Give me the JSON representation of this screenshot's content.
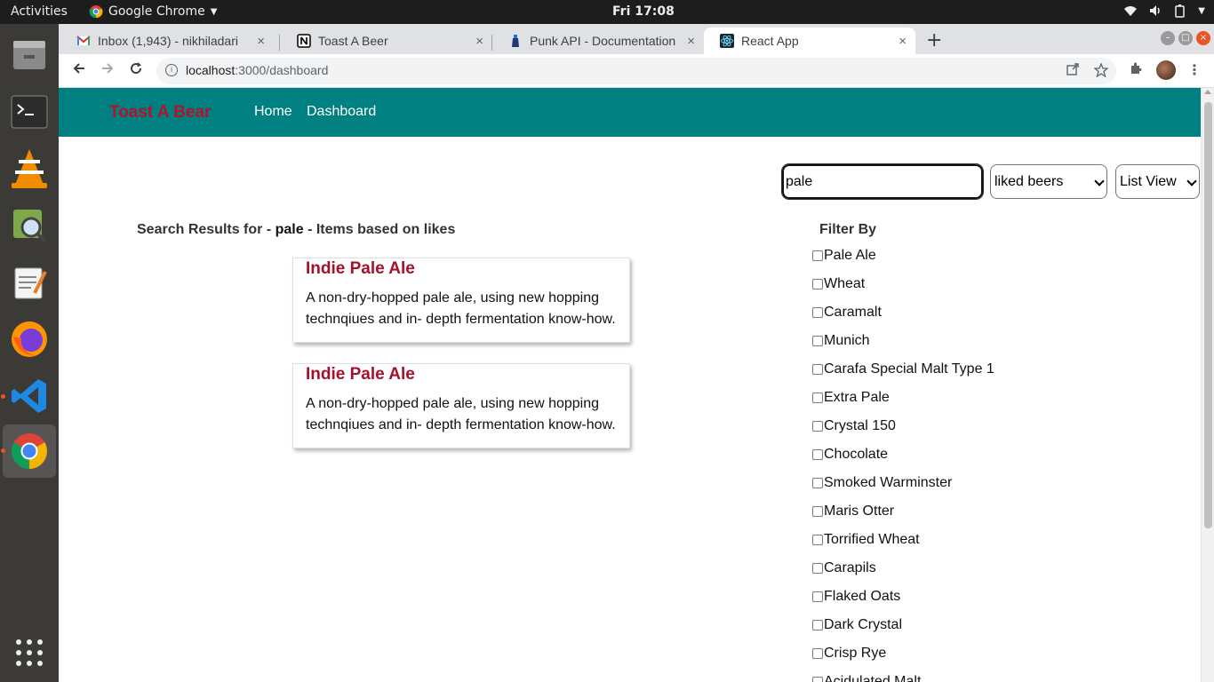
{
  "system_bar": {
    "activities": "Activities",
    "app_name": "Google Chrome",
    "clock": "Fri 17:08"
  },
  "dock": {
    "items": [
      {
        "name": "files-icon"
      },
      {
        "name": "terminal-icon"
      },
      {
        "name": "vlc-icon"
      },
      {
        "name": "image-viewer-icon"
      },
      {
        "name": "text-editor-icon"
      },
      {
        "name": "firefox-icon"
      },
      {
        "name": "vscode-icon"
      },
      {
        "name": "chrome-icon"
      }
    ],
    "show_apps": "show-apps-icon"
  },
  "browser": {
    "tabs": [
      {
        "title": "Inbox (1,943) - nikhiladari",
        "icon": "gmail-icon",
        "close": "×"
      },
      {
        "title": "Toast A Beer",
        "icon": "notion-icon",
        "close": "×"
      },
      {
        "title": "Punk API - Documentation",
        "icon": "punk-api-icon",
        "close": "×"
      },
      {
        "title": "React App",
        "icon": "react-icon",
        "close": "×"
      }
    ],
    "new_tab": "+",
    "url_host": "localhost",
    "url_rest": ":3000/dashboard"
  },
  "app": {
    "brand": "Toast A Bear",
    "nav": {
      "home": "Home",
      "dashboard": "Dashboard"
    },
    "search": {
      "value": "pale"
    },
    "sort_select": {
      "selected": "liked beers"
    },
    "view_select": {
      "selected": "List View"
    },
    "results_prefix": "Search Results for - ",
    "results_query": "pale",
    "results_suffix": " - Items based on likes",
    "cards": [
      {
        "title": "Indie Pale Ale",
        "description": "A non-dry-hopped pale ale, using new hopping technqiues and in- depth fermentation know-how."
      },
      {
        "title": "Indie Pale Ale",
        "description": "A non-dry-hopped pale ale, using new hopping technqiues and in- depth fermentation know-how."
      }
    ],
    "filter": {
      "title": "Filter By",
      "options": [
        "Pale Ale",
        "Wheat",
        "Caramalt",
        "Munich",
        "Carafa Special Malt Type 1",
        "Extra Pale",
        "Crystal 150",
        "Chocolate",
        "Smoked Warminster",
        "Maris Otter",
        "Torrified Wheat",
        "Carapils",
        "Flaked Oats",
        "Dark Crystal",
        "Crisp Rye",
        "Acidulated Malt"
      ]
    }
  },
  "colors": {
    "navbar": "#008080",
    "brand": "#b3122e",
    "card_title": "#a8102a"
  }
}
